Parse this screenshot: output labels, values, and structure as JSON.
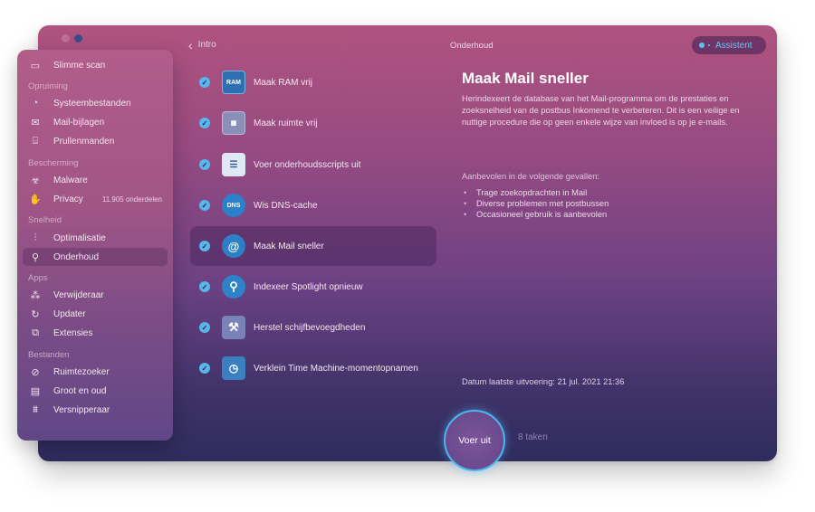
{
  "window": {
    "title": "Onderhoud"
  },
  "topbar": {
    "back_label": "Intro",
    "title": "Onderhoud",
    "assistant_label": "Assistent"
  },
  "sidebar": {
    "items": [
      {
        "label": "Slimme scan",
        "icon": "monitor-icon"
      },
      {
        "section": "Opruiming"
      },
      {
        "label": "Systeembestanden",
        "icon": "cleanup-icon"
      },
      {
        "label": "Mail-bijlagen",
        "icon": "envelope-icon"
      },
      {
        "label": "Prullenmanden",
        "icon": "trash-icon"
      },
      {
        "section": "Bescherming"
      },
      {
        "label": "Malware",
        "icon": "biohazard-icon"
      },
      {
        "label": "Privacy",
        "icon": "hand-icon",
        "count": "11.905 onderdelen"
      },
      {
        "section": "Snelheid"
      },
      {
        "label": "Optimalisatie",
        "icon": "sliders-icon"
      },
      {
        "label": "Onderhoud",
        "icon": "wrench-icon",
        "active": true
      },
      {
        "section": "Apps"
      },
      {
        "label": "Verwijderaar",
        "icon": "uninstaller-icon"
      },
      {
        "label": "Updater",
        "icon": "updater-icon"
      },
      {
        "label": "Extensies",
        "icon": "extensions-icon"
      },
      {
        "section": "Bestanden"
      },
      {
        "label": "Ruimtezoeker",
        "icon": "space-lens-icon"
      },
      {
        "label": "Groot en oud",
        "icon": "folder-icon"
      },
      {
        "label": "Versnipperaar",
        "icon": "shredder-icon"
      }
    ]
  },
  "tasks": [
    {
      "label": "Maak RAM vrij",
      "icon": "ram-icon",
      "icon_text": "RAM",
      "checked": true
    },
    {
      "label": "Maak ruimte vrij",
      "icon": "disk-icon",
      "checked": true
    },
    {
      "label": "Voer onderhoudsscripts uit",
      "icon": "script-icon",
      "checked": true
    },
    {
      "label": "Wis DNS-cache",
      "icon": "dns-icon",
      "icon_text": "DNS",
      "checked": true
    },
    {
      "label": "Maak Mail sneller",
      "icon": "mail-speed-icon",
      "checked": true,
      "selected": true
    },
    {
      "label": "Indexeer Spotlight opnieuw",
      "icon": "spotlight-icon",
      "checked": true
    },
    {
      "label": "Herstel schijfbevoegdheden",
      "icon": "repair-disk-icon",
      "checked": true
    },
    {
      "label": "Verklein Time Machine-momentopnamen",
      "icon": "time-machine-icon",
      "checked": true
    }
  ],
  "detail": {
    "title": "Maak Mail sneller",
    "description": "Herindexeert de database van het Mail-programma om de prestaties en zoeksnelheid van de postbus Inkomend te verbeteren. Dit is een veilige en nuttige procedure die op geen enkele wijze van invloed is op je e-mails.",
    "recommended_heading": "Aanbevolen in de volgende gevallen:",
    "recommended": [
      "Trage zoekopdrachten in Mail",
      "Diverse problemen met postbussen",
      "Occasioneel gebruik is aanbevolen"
    ],
    "last_run_label": "Datum laatste uitvoering:",
    "last_run_value": "21 jul. 2021 21:36"
  },
  "footer": {
    "run_label": "Voer uit",
    "task_count": "8 taken"
  },
  "colors": {
    "accent": "#58b6ea",
    "assistant": "#5bc2f0"
  }
}
